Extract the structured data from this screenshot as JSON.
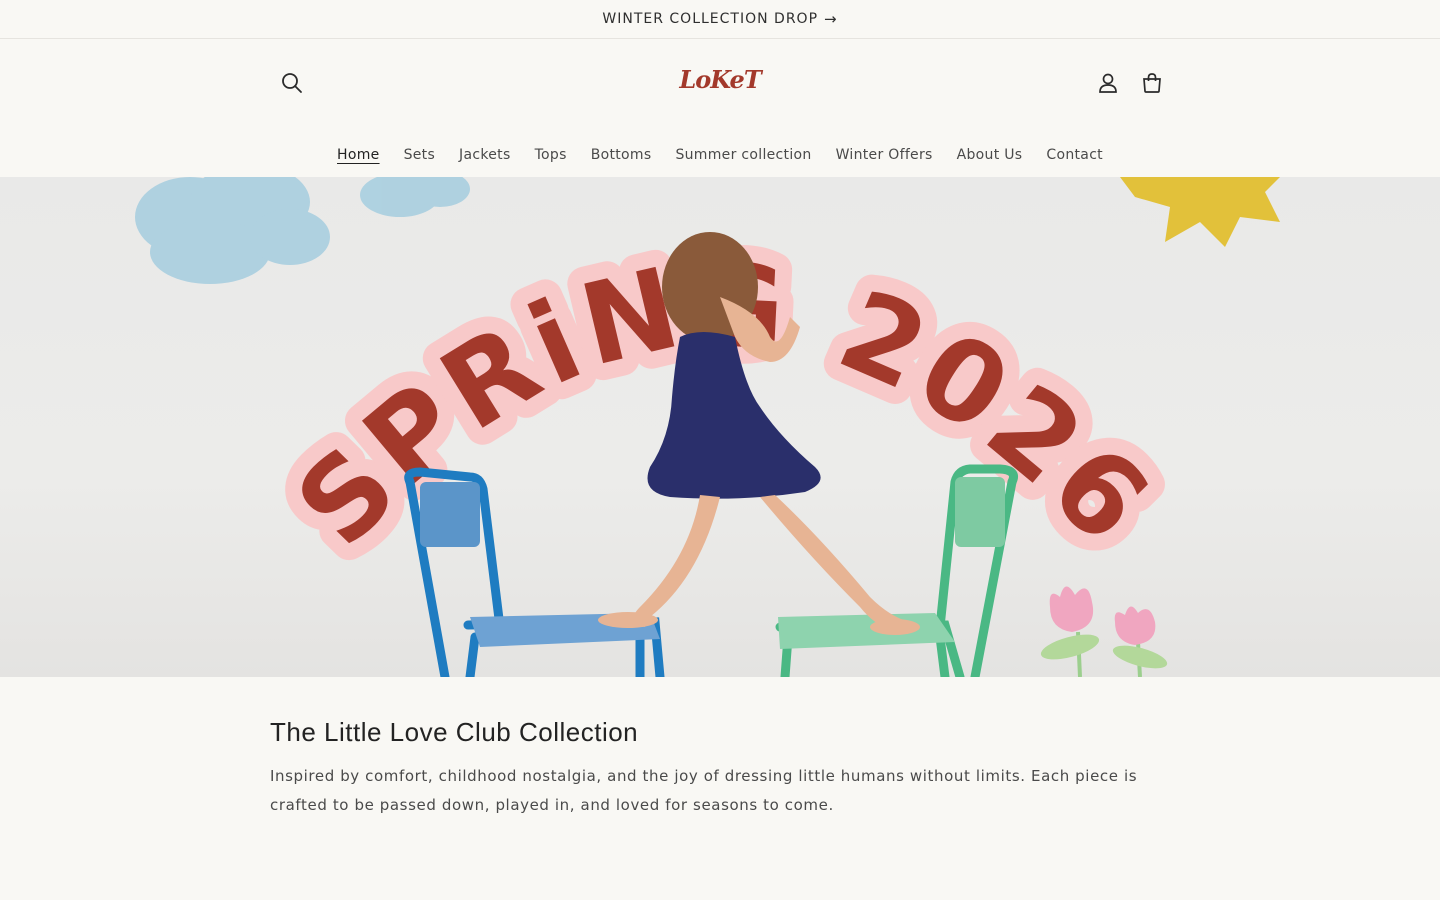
{
  "announcement": {
    "text": "WINTER COLLECTION DROP",
    "arrow": "→"
  },
  "header": {
    "logo": "LoKeT",
    "icons": {
      "search": "search-icon",
      "account": "account-icon",
      "cart": "cart-icon"
    }
  },
  "nav": {
    "items": [
      {
        "label": "Home",
        "active": true
      },
      {
        "label": "Sets"
      },
      {
        "label": "Jackets"
      },
      {
        "label": "Tops"
      },
      {
        "label": "Bottoms"
      },
      {
        "label": "Summer collection"
      },
      {
        "label": "Winter Offers"
      },
      {
        "label": "About Us"
      },
      {
        "label": "Contact"
      }
    ]
  },
  "hero": {
    "headline": "SPRiNG 2026",
    "colors": {
      "text": "#a3392b",
      "outline": "#f8c9c9",
      "cloud": "#a9cfe0",
      "sun": "#e2c13a"
    }
  },
  "intro": {
    "title": "The Little Love Club Collection",
    "body": "Inspired by comfort, childhood nostalgia, and the joy of dressing little humans without limits. Each piece is crafted to be passed down, played in, and loved for seasons to come."
  }
}
